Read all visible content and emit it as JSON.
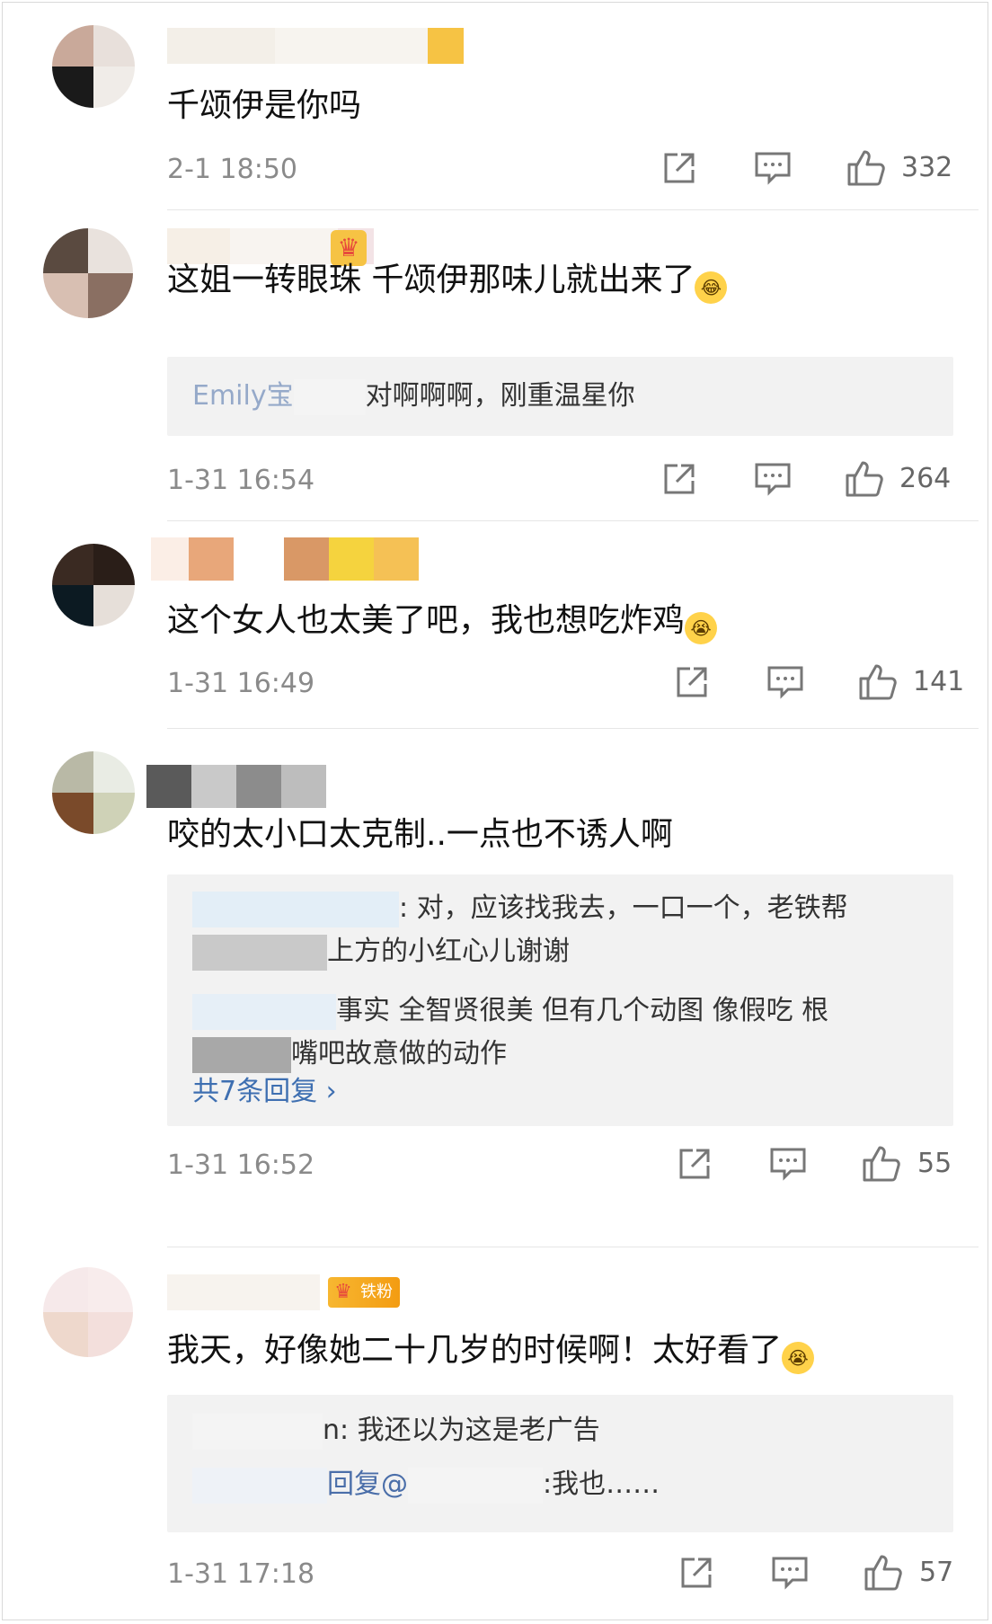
{
  "comments": [
    {
      "text": "千颂伊是你吗",
      "badge": "",
      "time": "2-1 18:50",
      "likes": "332",
      "replies": [],
      "more": ""
    },
    {
      "text": "这姐一转眼珠 千颂伊那味儿就出来了",
      "emoji": "😂",
      "time": "1-31 16:54",
      "likes": "264",
      "replies": [
        {
          "author": "Emily宝",
          "body": "对啊啊啊，刚重温星你"
        }
      ],
      "more": ""
    },
    {
      "text": "这个女人也太美了吧，我也想吃炸鸡",
      "emoji": "😭",
      "time": "1-31 16:49",
      "likes": "141",
      "replies": [],
      "more": ""
    },
    {
      "text": "咬的太小口太克制..一点也不诱人啊",
      "time": "1-31 16:52",
      "likes": "55",
      "replies": [
        {
          "author": "",
          "body": ": 对，应该找我去，一口一个，老铁帮",
          "body2": "上方的小红心儿谢谢"
        },
        {
          "author": "",
          "body": "事实 全智贤很美 但有几个动图 像假吃 根",
          "body2": "嘴吧故意做的动作"
        }
      ],
      "more": "共7条回复"
    },
    {
      "text": "我天，好像她二十几岁的时候啊！太好看了",
      "emoji": "😭",
      "badge": "铁粉",
      "time": "1-31 17:18",
      "likes": "57",
      "replies": [
        {
          "author": "",
          "body": "n: 我还以为这是老广告"
        },
        {
          "author": "",
          "body": "回复@",
          "body2": ":我也……"
        }
      ],
      "more": ""
    }
  ],
  "icons": {
    "share": "share-icon",
    "comment": "comment-icon",
    "like": "thumbs-up-icon"
  },
  "colors": {
    "link": "#3e6fb1",
    "badge": "#f39c12",
    "muted": "#8a8a8a"
  }
}
